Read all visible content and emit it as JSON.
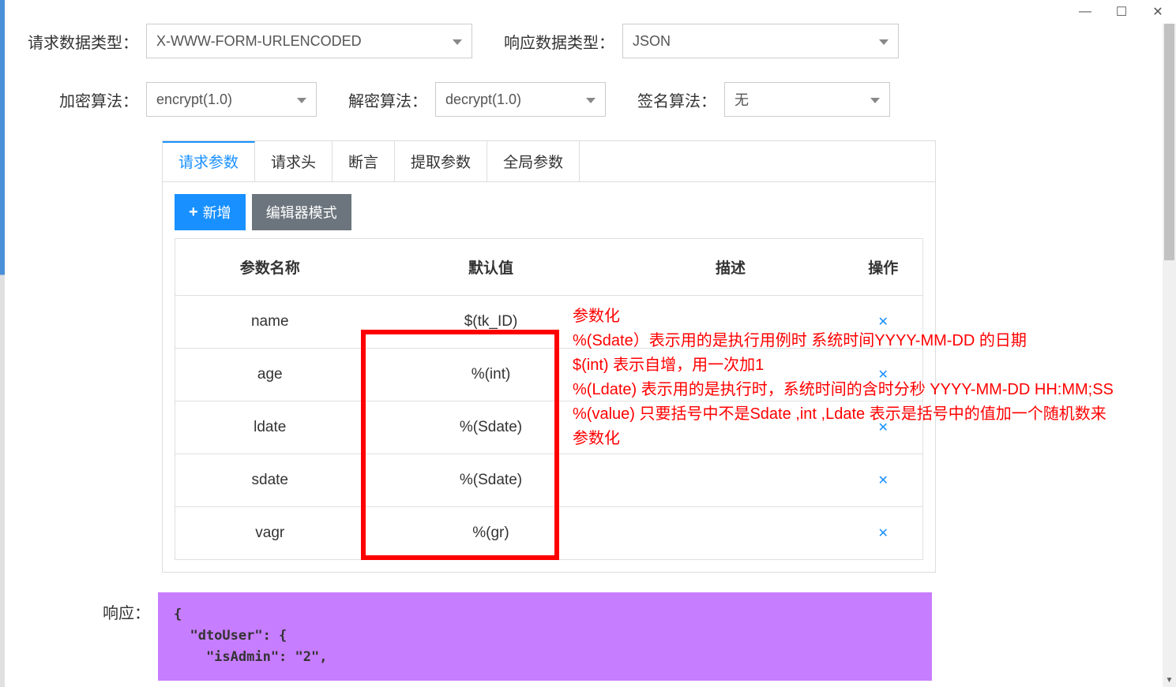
{
  "titlebar": {
    "minimize": "—",
    "maximize": "□",
    "close": "✕"
  },
  "form": {
    "requestDataTypeLabel": "请求数据类型：",
    "requestDataTypeValue": "X-WWW-FORM-URLENCODED",
    "responseDataTypeLabel": "响应数据类型：",
    "responseDataTypeValue": "JSON",
    "encryptLabel": "加密算法：",
    "encryptValue": "encrypt(1.0)",
    "decryptLabel": "解密算法：",
    "decryptValue": "decrypt(1.0)",
    "signLabel": "签名算法：",
    "signValue": "无"
  },
  "tabs": [
    {
      "label": "请求参数",
      "active": true
    },
    {
      "label": "请求头",
      "active": false
    },
    {
      "label": "断言",
      "active": false
    },
    {
      "label": "提取参数",
      "active": false
    },
    {
      "label": "全局参数",
      "active": false
    }
  ],
  "buttons": {
    "add": "新增",
    "editorMode": "编辑器模式"
  },
  "table": {
    "headers": {
      "paramName": "参数名称",
      "defaultValue": "默认值",
      "description": "描述",
      "action": "操作"
    },
    "rows": [
      {
        "name": "name",
        "default": "$(tk_ID)",
        "desc": ""
      },
      {
        "name": "age",
        "default": "%(int)",
        "desc": ""
      },
      {
        "name": "ldate",
        "default": "%(Sdate)",
        "desc": ""
      },
      {
        "name": "sdate",
        "default": "%(Sdate)",
        "desc": ""
      },
      {
        "name": "vagr",
        "default": "%(gr)",
        "desc": ""
      }
    ]
  },
  "annotation": {
    "title": "参数化",
    "line1": "%(Sdate）表示用的是执行用例时 系统时间YYYY-MM-DD 的日期",
    "line2": "$(int)  表示自增，用一次加1",
    "line3": "%(Ldate)  表示用的是执行时，系统时间的含时分秒  YYYY-MM-DD HH:MM;SS",
    "line4": "%(value)  只要括号中不是Sdate ,int ,Ldate 表示是括号中的值加一个随机数来参数化"
  },
  "response": {
    "label": "响应：",
    "body": "{\n  \"dtoUser\": {\n    \"isAdmin\": \"2\","
  }
}
